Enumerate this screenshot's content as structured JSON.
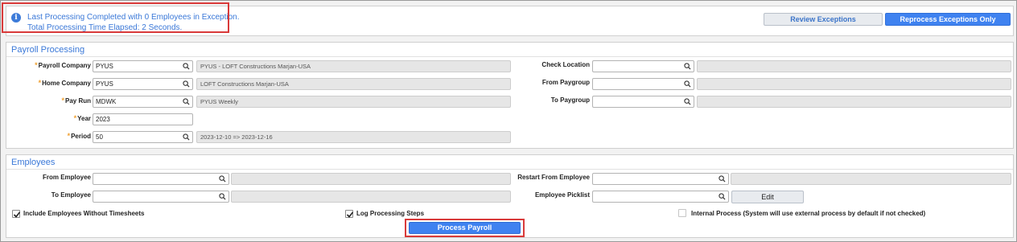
{
  "status": {
    "line1": "Last Processing Completed with 0 Employees in Exception.",
    "line2": "Total Processing Time Elapsed: 2 Seconds.",
    "icon": "info-icon"
  },
  "actions": {
    "review_exceptions": "Review Exceptions",
    "reprocess_exceptions": "Reprocess Exceptions Only"
  },
  "payroll": {
    "title": "Payroll Processing",
    "required_marker": "*",
    "payroll_company": {
      "label": "Payroll Company",
      "value": "PYUS",
      "desc": "PYUS - LOFT Constructions Marjan-USA"
    },
    "home_company": {
      "label": "Home Company",
      "value": "PYUS",
      "desc": "LOFT Constructions Marjan-USA"
    },
    "pay_run": {
      "label": "Pay Run",
      "value": "MDWK",
      "desc": "PYUS Weekly"
    },
    "year": {
      "label": "Year",
      "value": "2023"
    },
    "period": {
      "label": "Period",
      "value": "50",
      "desc": "2023-12-10  =>  2023-12-16"
    },
    "check_location": {
      "label": "Check Location",
      "value": "",
      "desc": ""
    },
    "from_paygroup": {
      "label": "From Paygroup",
      "value": "",
      "desc": ""
    },
    "to_paygroup": {
      "label": "To Paygroup",
      "value": "",
      "desc": ""
    }
  },
  "employees": {
    "title": "Employees",
    "from_employee": {
      "label": "From Employee",
      "value": "",
      "desc": ""
    },
    "to_employee": {
      "label": "To Employee",
      "value": "",
      "desc": ""
    },
    "restart_from_employee": {
      "label": "Restart From Employee",
      "value": "",
      "desc": ""
    },
    "employee_picklist": {
      "label": "Employee Picklist",
      "value": "",
      "edit_label": "Edit"
    },
    "include_without_timesheets": {
      "label": "Include Employees Without Timesheets",
      "checked": true
    },
    "log_processing_steps": {
      "label": "Log Processing Steps",
      "checked": true
    },
    "internal_process": {
      "label": "Internal Process (System will use external process by default if not checked)",
      "checked": false
    }
  },
  "process_button": "Process Payroll",
  "colors": {
    "accent": "#3f82f0",
    "title_blue": "#3a78d8",
    "required": "#f0a030",
    "highlight": "#d93a3a"
  }
}
